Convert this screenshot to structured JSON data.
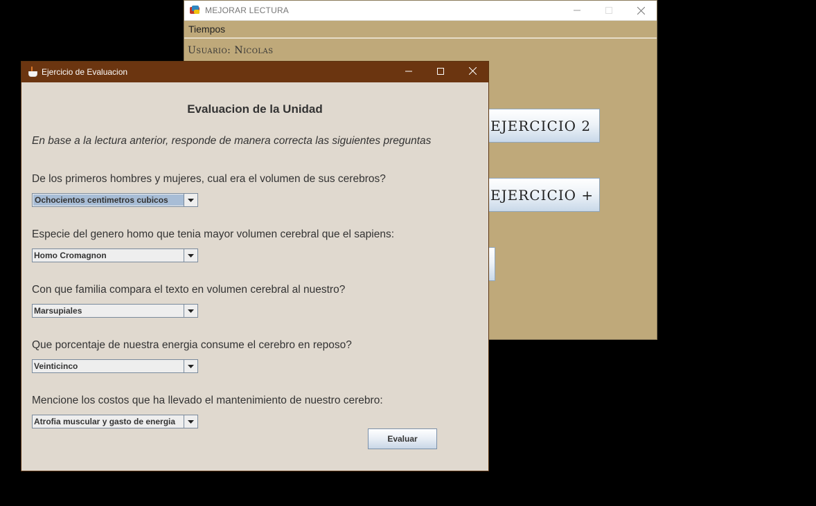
{
  "background_window": {
    "title": "MEJORAR LECTURA",
    "menu": [
      "Tiempos"
    ],
    "user_label": "Usuario: Nicolas",
    "buttons": [
      "EJERCICIO 2",
      "EJERCICIO +"
    ]
  },
  "dialog": {
    "title": "Ejercicio de Evaluacion",
    "heading": "Evaluacion de la Unidad",
    "instruction": "En base a la lectura anterior, responde de manera correcta las siguientes preguntas",
    "questions": [
      {
        "text": "De los primeros hombres y mujeres, cual era el volumen de sus cerebros?",
        "selected": "Ochocientos centimetros cubicos"
      },
      {
        "text": "Especie del genero homo que tenia mayor volumen cerebral que el sapiens:",
        "selected": "Homo Cromagnon"
      },
      {
        "text": "Con que familia compara el texto en volumen cerebral al nuestro?",
        "selected": "Marsupiales"
      },
      {
        "text": "Que porcentaje de nuestra energia consume el cerebro en reposo?",
        "selected": "Veinticinco"
      },
      {
        "text": "Mencione los costos que ha llevado el mantenimiento de nuestro cerebro:",
        "selected": "Atrofia muscular y gasto de energia"
      }
    ],
    "submit_label": "Evaluar"
  },
  "colors": {
    "dialog_titlebar": "#6b3510",
    "dialog_body": "#e0d9cf",
    "background_window_body": "#bfa97a"
  },
  "icons": [
    "app-icon",
    "java-icon",
    "minimize-icon",
    "maximize-icon",
    "close-icon",
    "dropdown-arrow-icon"
  ]
}
